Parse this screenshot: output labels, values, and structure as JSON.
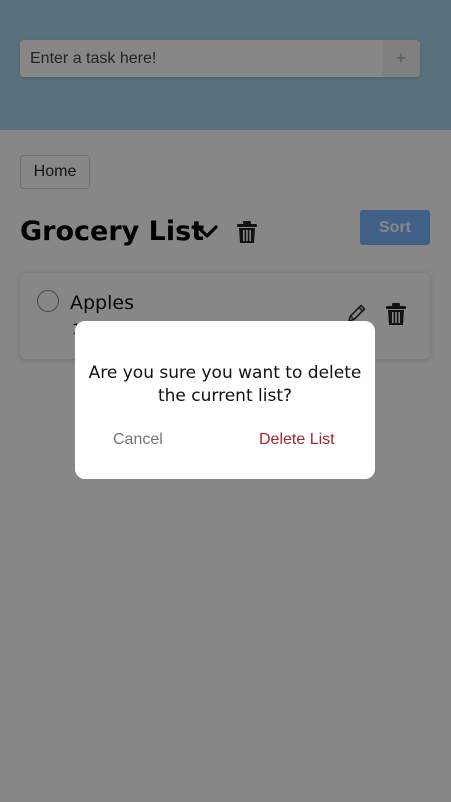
{
  "header": {
    "task_input": {
      "placeholder": "Enter a task here!",
      "value": ""
    },
    "add_button_label": "+"
  },
  "nav": {
    "home_label": "Home"
  },
  "list": {
    "title": "Grocery List",
    "sort_label": "Sort",
    "tasks": [
      {
        "name": "Apples",
        "sub": "1"
      }
    ]
  },
  "dialog": {
    "message": "Are you sure you want to delete the current list?",
    "cancel_label": "Cancel",
    "confirm_label": "Delete List"
  },
  "colors": {
    "header_bg": "#a9d6ea",
    "sort_button": "#7ab5ff",
    "delete_text": "#a3262a",
    "cancel_text": "#757575"
  },
  "icons": [
    "chevron-down-icon",
    "trash-icon",
    "pencil-icon",
    "radio-circle-icon"
  ]
}
